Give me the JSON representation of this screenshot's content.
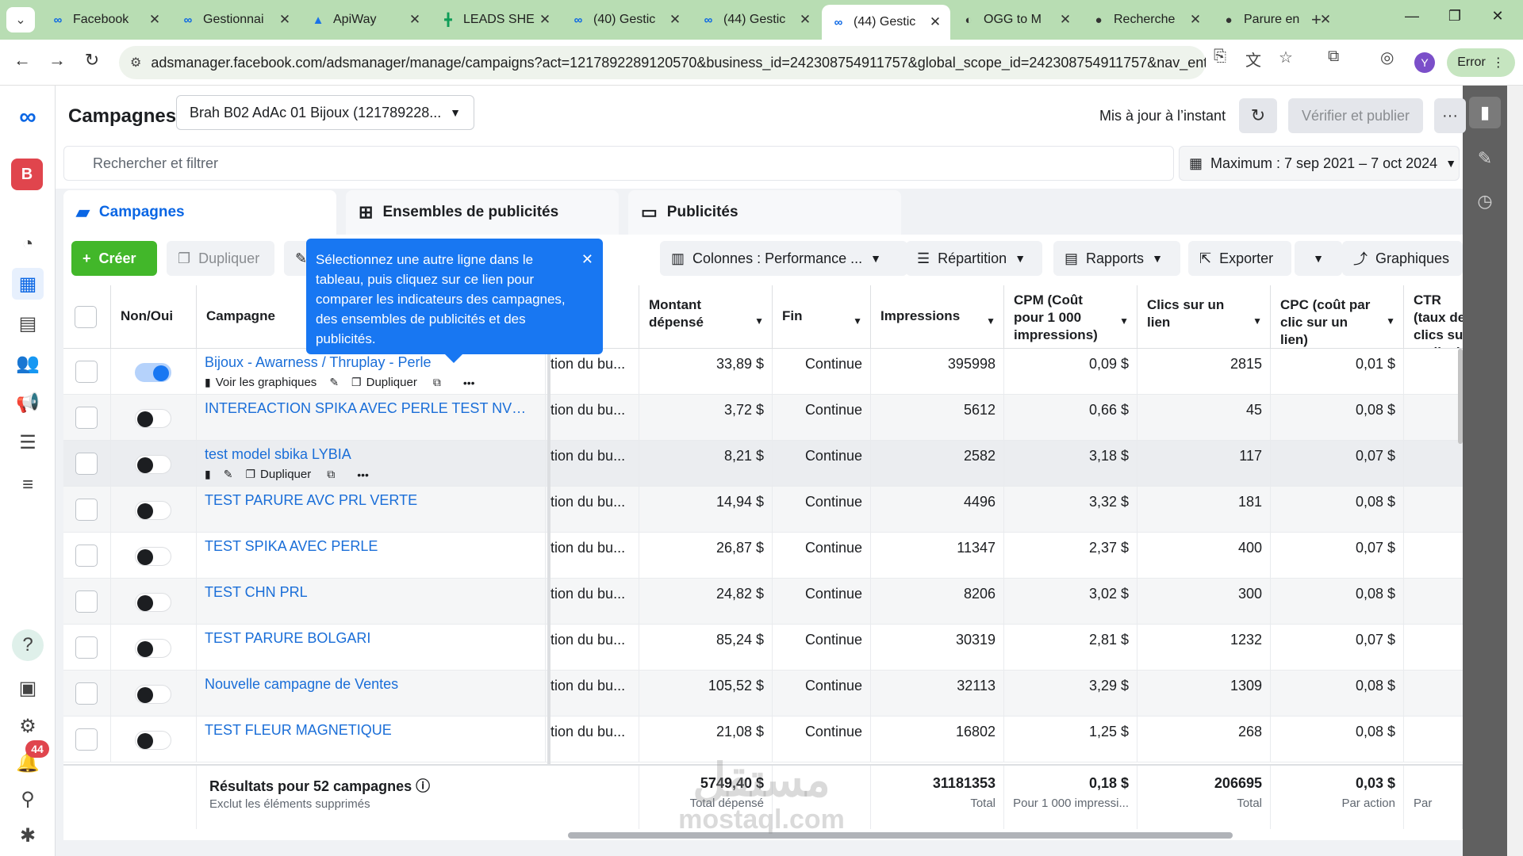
{
  "browser": {
    "tabs": [
      {
        "icon": "meta-icon",
        "glyph": "∞",
        "title": "Facebook"
      },
      {
        "icon": "meta-icon",
        "glyph": "∞",
        "title": "Gestionnai"
      },
      {
        "icon": "apiway-icon",
        "glyph": "▲",
        "title": "ApiWay"
      },
      {
        "icon": "sheets-icon",
        "glyph": "╋",
        "title": "LEADS SHE"
      },
      {
        "icon": "meta-icon",
        "glyph": "∞",
        "title": "(40) Gestic"
      },
      {
        "icon": "meta-icon",
        "glyph": "∞",
        "title": "(44) Gestic"
      },
      {
        "icon": "meta-icon",
        "glyph": "∞",
        "title": "(44) Gestic"
      },
      {
        "icon": "ogg-icon",
        "glyph": "◐",
        "title": "OGG to M"
      },
      {
        "icon": "circle-icon",
        "glyph": "●",
        "title": "Recherche"
      },
      {
        "icon": "circle-icon",
        "glyph": "●",
        "title": "Parure en"
      }
    ],
    "active_tab": 6,
    "url": "adsmanager.facebook.com/adsmanager/manage/campaigns?act=1217892289120570&business_id=242308754911757&global_scope_id=242308754911757&nav_entry_...",
    "profile_letter": "Y",
    "error_label": "Error"
  },
  "rail": {
    "account_letter": "B",
    "notification_count": "44"
  },
  "header": {
    "title": "Campagnes",
    "account": "Brah B02 AdAc 01 Bijoux (121789228...",
    "updated": "Mis à jour à l’instant",
    "publish": "Vérifier et publier",
    "search_placeholder": "Rechercher et filtrer",
    "date_range": "Maximum : 7 sep 2021 – 7 oct 2024"
  },
  "level_tabs": {
    "campaigns": "Campagnes",
    "adsets": "Ensembles de publicités",
    "ads": "Publicités"
  },
  "toolbar": {
    "create": "Créer",
    "duplicate": "Dupliquer",
    "columns": "Colonnes : Performance ...",
    "breakdown": "Répartition",
    "reports": "Rapports",
    "export": "Exporter",
    "charts": "Graphiques"
  },
  "tooltip": {
    "text": "Sélectionnez une autre ligne dans le tableau, puis cliquez sur ce lien pour comparer les indicateurs des campagnes, des ensembles de publicités et des publicités."
  },
  "table": {
    "headers": {
      "onoff": "Non/Oui",
      "campaign": "Campagne",
      "spent": "Montant dépensé",
      "end": "Fin",
      "impressions": "Impressions",
      "cpm": "CPM (Coût pour 1 000 impressions)",
      "clicks": "Clics sur un lien",
      "cpc": "CPC (coût par clic sur un lien)",
      "ctr": "CTR (taux de clics sur un lien)"
    },
    "row_actions": {
      "charts": "Voir les graphiques",
      "duplicate": "Dupliquer"
    },
    "rows": [
      {
        "on": true,
        "name": "Bijoux - Awarness / Thruplay - Perle",
        "strategy": "ition du bu...",
        "spent": "33,89 $",
        "end": "Continue",
        "impressions": "395998",
        "cpm": "0,09 $",
        "clicks": "2815",
        "cpc": "0,01 $"
      },
      {
        "on": false,
        "name": "INTEREACTION SPIKA AVEC PERLE TEST NVL STR...",
        "strategy": "ition du bu...",
        "spent": "3,72 $",
        "end": "Continue",
        "impressions": "5612",
        "cpm": "0,66 $",
        "clicks": "45",
        "cpc": "0,08 $"
      },
      {
        "on": false,
        "name": "test model sbika LYBIA",
        "strategy": "ition du bu...",
        "spent": "8,21 $",
        "end": "Continue",
        "impressions": "2582",
        "cpm": "3,18 $",
        "clicks": "117",
        "cpc": "0,07 $"
      },
      {
        "on": false,
        "name": "TEST PARURE AVC PRL VERTE",
        "strategy": "ition du bu...",
        "spent": "14,94 $",
        "end": "Continue",
        "impressions": "4496",
        "cpm": "3,32 $",
        "clicks": "181",
        "cpc": "0,08 $"
      },
      {
        "on": false,
        "name": "TEST SPIKA AVEC PERLE",
        "strategy": "ition du bu...",
        "spent": "26,87 $",
        "end": "Continue",
        "impressions": "11347",
        "cpm": "2,37 $",
        "clicks": "400",
        "cpc": "0,07 $"
      },
      {
        "on": false,
        "name": "TEST CHN PRL",
        "strategy": "ition du bu...",
        "spent": "24,82 $",
        "end": "Continue",
        "impressions": "8206",
        "cpm": "3,02 $",
        "clicks": "300",
        "cpc": "0,08 $"
      },
      {
        "on": false,
        "name": "TEST PARURE BOLGARI",
        "strategy": "ition du bu...",
        "spent": "85,24 $",
        "end": "Continue",
        "impressions": "30319",
        "cpm": "2,81 $",
        "clicks": "1232",
        "cpc": "0,07 $"
      },
      {
        "on": false,
        "name": "Nouvelle campagne de Ventes",
        "strategy": "ition du bu...",
        "spent": "105,52 $",
        "end": "Continue",
        "impressions": "32113",
        "cpm": "3,29 $",
        "clicks": "1309",
        "cpc": "0,08 $"
      },
      {
        "on": false,
        "name": "TEST FLEUR MAGNETIQUE",
        "strategy": "ition du bu...",
        "spent": "21,08 $",
        "end": "Continue",
        "impressions": "16802",
        "cpm": "1,25 $",
        "clicks": "268",
        "cpc": "0,08 $"
      }
    ],
    "summary": {
      "title": "Résultats pour 52 campagnes",
      "subtitle": "Exclut les éléments supprimés",
      "spent": "5749,40 $",
      "spent_label": "Total dépensé",
      "impressions": "31181353",
      "impressions_label": "Total",
      "cpm": "0,18 $",
      "cpm_label": "Pour 1 000 impressi...",
      "clicks": "206695",
      "clicks_label": "Total",
      "cpc": "0,03 $",
      "cpc_label": "Par action",
      "ctr_label": "Par"
    }
  },
  "watermark": {
    "line1": "مستقل",
    "line2": "mostaql.com"
  }
}
